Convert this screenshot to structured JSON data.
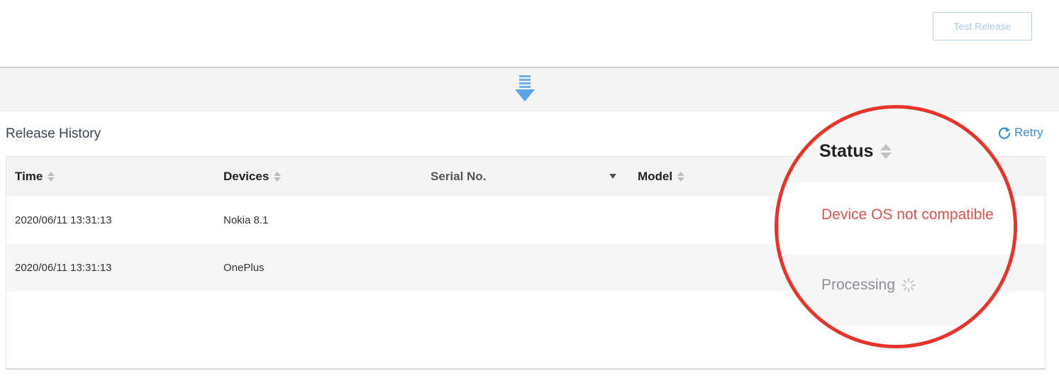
{
  "toolbar": {
    "test_release_label": "Test Release"
  },
  "section": {
    "title": "Release History",
    "retry_label": "Retry"
  },
  "table": {
    "columns": [
      "Time",
      "Devices",
      "Serial No.",
      "Model"
    ],
    "rows": [
      {
        "time": "2020/06/11 13:31:13",
        "device": "Nokia 8.1",
        "serial": "",
        "model": ""
      },
      {
        "time": "2020/06/11 13:31:13",
        "device": "OnePlus",
        "serial": "",
        "model": ""
      }
    ]
  },
  "magnifier": {
    "status_header": "Status",
    "status_row1": "Device OS not compatible",
    "status_row2": "Processing"
  },
  "colors": {
    "accent": "#3a8fd6",
    "error": "#e0524f",
    "highlight_circle": "#e8332a"
  },
  "icons": [
    "download-arrow-icon",
    "refresh-icon",
    "sort-icon",
    "filter-caret-icon",
    "spinner-icon"
  ]
}
